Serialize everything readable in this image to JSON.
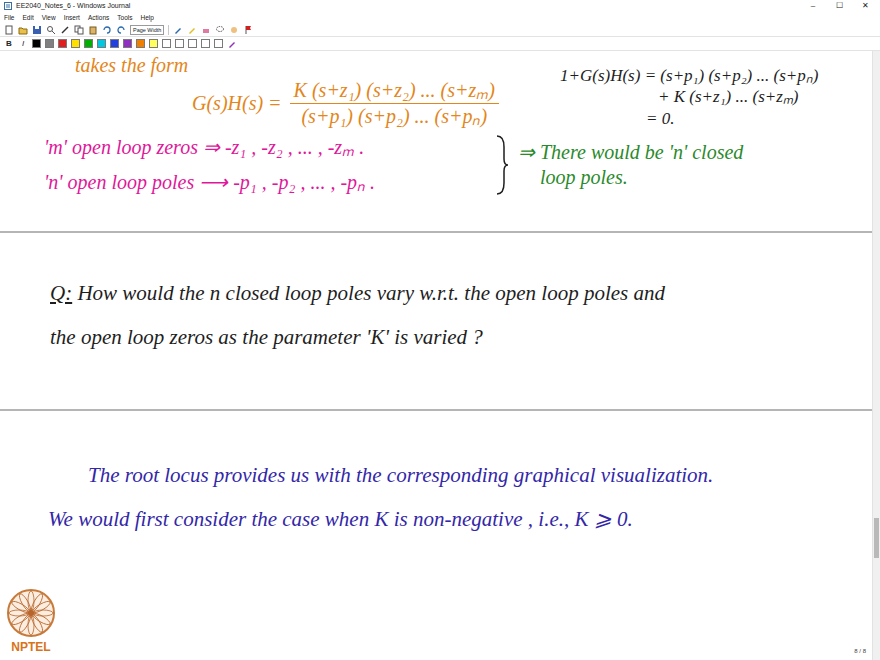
{
  "window": {
    "title": "EE2040_Notes_6 - Windows Journal",
    "controls": [
      "–",
      "☐",
      "✕"
    ]
  },
  "menu": [
    "File",
    "Edit",
    "View",
    "Insert",
    "Actions",
    "Tools",
    "Help"
  ],
  "toolbar": {
    "zoom": "Page Width"
  },
  "format": [
    "B",
    "I"
  ],
  "palette": [
    {
      "color": "#000000"
    },
    {
      "color": "#808080"
    },
    {
      "color": "#e02020"
    },
    {
      "color": "#ffe000"
    },
    {
      "color": "#00b000"
    },
    {
      "color": "#00c8e0"
    },
    {
      "color": "#2040e0"
    },
    {
      "color": "#9030c0"
    },
    {
      "color": "#f08000"
    },
    {
      "color": "#ffff60"
    },
    {
      "color": "#ffffff"
    },
    {
      "color": "#ffffff"
    },
    {
      "color": "#ffffff"
    },
    {
      "color": "#ffffff"
    },
    {
      "color": "#ffffff"
    }
  ],
  "note": {
    "intro": "takes the form",
    "transfer": {
      "lhs": "G(s)H(s) =",
      "numerator": "K (s+z₁) (s+z₂) ... (s+zₘ)",
      "denominator": "(s+p₁) (s+p₂) ... (s+pₙ)"
    },
    "char_eq": [
      "1+G(s)H(s) = (s+p₁) (s+p₂) ... (s+pₙ)",
      "+ K (s+z₁) ... (s+zₘ)",
      "= 0."
    ],
    "zeros": "'m' open loop zeros ⇒ -z₁ , -z₂ , ... , -zₘ .",
    "poles": "'n' open loop poles ⟶ -p₁ , -p₂ , ... , -pₙ .",
    "conclusion": [
      "⇒ There would be 'n' closed",
      "loop poles."
    ],
    "question_label": "Q:",
    "question": [
      "How would the n closed loop poles vary w.r.t. the open loop poles and",
      "the open loop zeros as the parameter 'K' is varied ?"
    ],
    "answer": [
      "The root locus provides us with the corresponding graphical visualization.",
      "We would first consider the case when K is non-negative , i.e., K ⩾ 0."
    ]
  },
  "logo": "NPTEL",
  "page_indicator": "8 / 8",
  "scrollbar": {
    "level": 0.82
  }
}
